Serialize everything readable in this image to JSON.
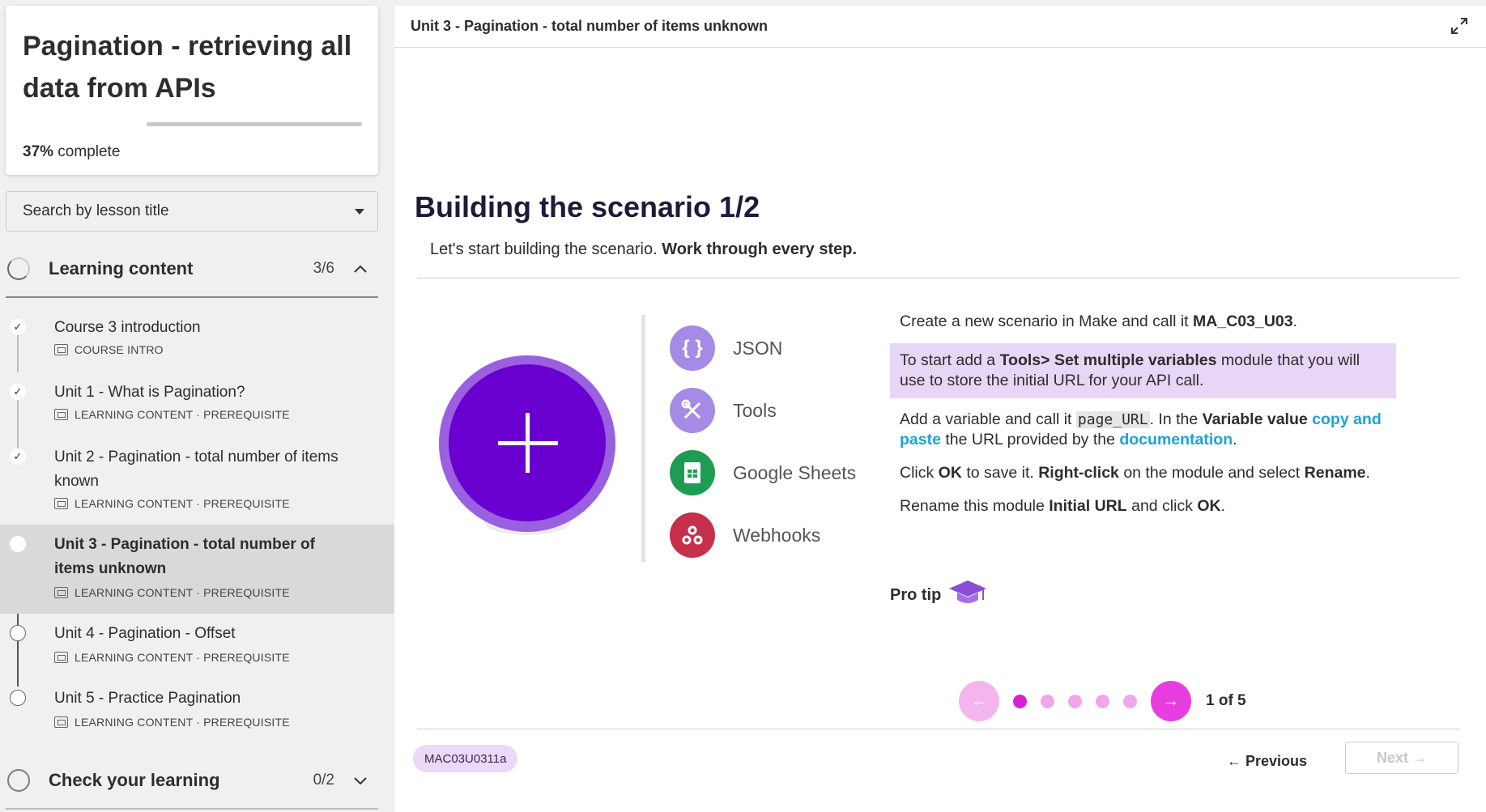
{
  "course": {
    "title": "Pagination - retrieving all data from APIs",
    "progress_percent": 37,
    "progress_value": "37%",
    "progress_suffix": " complete"
  },
  "search": {
    "placeholder": "Search by lesson title"
  },
  "sections": [
    {
      "title": "Learning content",
      "count": "3/6",
      "expanded": true
    },
    {
      "title": "Check your learning",
      "count": "0/2",
      "expanded": false
    }
  ],
  "lessons": [
    {
      "title": "Course 3 introduction",
      "meta": "COURSE INTRO",
      "state": "done",
      "check": "✓"
    },
    {
      "title": "Unit 1 - What is Pagination?",
      "meta": "LEARNING CONTENT · PREREQUISITE",
      "state": "done",
      "check": "✓"
    },
    {
      "title": "Unit 2 - Pagination - total number of items known",
      "meta": "LEARNING CONTENT · PREREQUISITE",
      "state": "done",
      "check": "✓"
    },
    {
      "title": "Unit 3 - Pagination - total number of items unknown",
      "meta": "LEARNING CONTENT · PREREQUISITE",
      "state": "current"
    },
    {
      "title": "Unit 4 - Pagination - Offset",
      "meta": "LEARNING CONTENT · PREREQUISITE",
      "state": "todo"
    },
    {
      "title": "Unit 5 - Practice Pagination",
      "meta": "LEARNING CONTENT · PREREQUISITE",
      "state": "todo"
    }
  ],
  "main": {
    "breadcrumb": "Unit 3 - Pagination - total number of items unknown",
    "slide_title": "Building the scenario 1/2",
    "subtitle_plain": "Let's start building the scenario. ",
    "subtitle_bold": "Work through every step.",
    "apps": [
      "JSON",
      "Tools",
      "Google Sheets",
      "Webhooks"
    ],
    "steps": {
      "s1_a": "Create a new scenario in Make and call it ",
      "s1_b": "MA_C03_U03",
      "s1_c": ".",
      "s2_a": "To start add a ",
      "s2_b": "Tools> Set multiple variables",
      "s2_c": " module that you will use to store the initial URL for your API call.",
      "s3_a": "Add a variable and call it ",
      "s3_code": "page_URL",
      "s3_b": ". In the ",
      "s3_c": "Variable value",
      "s3_d": " ",
      "s3_link1": "copy and paste",
      "s3_e": " the URL provided by the ",
      "s3_link2": "documentation",
      "s3_f": ".",
      "s4_a": "Click ",
      "s4_b": "OK",
      "s4_c": " to save it. ",
      "s4_d": "Right-click",
      "s4_e": " on the module and select ",
      "s4_f": "Rename",
      "s4_g": ".",
      "s5_a": "Rename this module ",
      "s5_b": "Initial URL",
      "s5_c": " and click ",
      "s5_d": "OK",
      "s5_e": "."
    },
    "pro_tip": "Pro tip",
    "pager": {
      "label": "1 of 5",
      "current": 1,
      "total": 5,
      "prev_arrow": "←",
      "next_arrow": "→"
    },
    "lesson_code": "MAC03U0311a",
    "nav": {
      "previous": "← Previous",
      "next": "Next →"
    }
  },
  "colors": {
    "accent_purple": "#6a00d0",
    "pager_active": "#e83ee0",
    "link_blue": "#1ba3d9",
    "highlight": "#e8d6f7"
  }
}
